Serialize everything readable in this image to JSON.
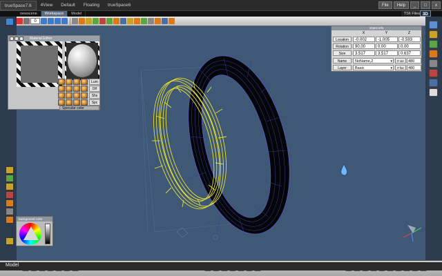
{
  "app": {
    "tabs": [
      "trueSpace7.6",
      "4View",
      "Default",
      "Floating",
      "trueSpace6"
    ],
    "file_menu": "File",
    "help_menu": "Help",
    "ts6_files": "TS6 Files",
    "view_badge": "3D"
  },
  "scene_tabs": [
    "newscene",
    "Workspace",
    "Model"
  ],
  "toolbar": {
    "frame_value": "0"
  },
  "material_panel": {
    "title": "Material Editor",
    "shader_labels": [
      "Lum",
      "Dif",
      "Shs",
      "Spc"
    ],
    "specular_label": "Specular color"
  },
  "color_panel": {
    "title": "background color"
  },
  "object_info": {
    "title": "object info",
    "columns": [
      "X",
      "Y",
      "Z"
    ],
    "rows": [
      {
        "label": "Location",
        "values": [
          "-0.002",
          "-1.005",
          "-0.593"
        ]
      },
      {
        "label": "Rotation",
        "values": [
          "90.00",
          "0.00",
          "0.00"
        ]
      },
      {
        "label": "Size",
        "values": [
          "3.517",
          "3.517",
          "0.637"
        ]
      }
    ],
    "name_label": "Name",
    "name_value": "NoName,2",
    "layer_label": "Layer",
    "layer_value": "Basic",
    "vert_label": "# ver",
    "vert_value": "480",
    "face_label": "# fac",
    "face_value": "480"
  },
  "status": {
    "mode": "Model"
  },
  "colors": {
    "viewport_bg": "#3f5876",
    "selected_wire": "#e8e233",
    "dark_torus": "#05060a",
    "dark_wire": "#5a5ac8",
    "panel_grey": "#c6c6c6"
  },
  "icons": [
    "arrow-icon",
    "sphere-icon",
    "cube-icon",
    "torus-icon",
    "teapot-icon",
    "camera-icon",
    "light-icon",
    "paint-icon",
    "axis-gizmo-icon",
    "droplet-icon"
  ]
}
